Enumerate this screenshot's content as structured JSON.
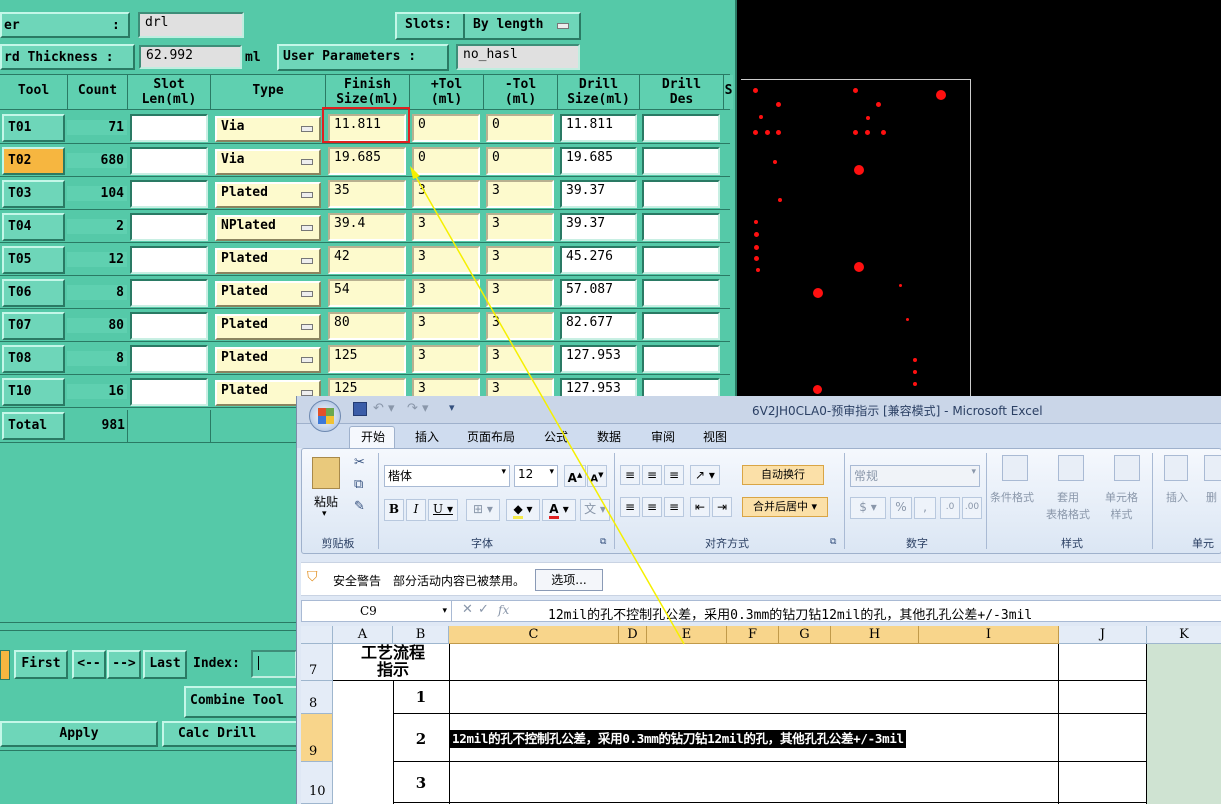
{
  "cam": {
    "header": {
      "layer_label": "er",
      "layer_sep": ":",
      "layer_value": "drl",
      "slots_label": "Slots:",
      "slots_value": "By length",
      "thickness_label": "rd Thickness :",
      "thickness_value": "62.992",
      "thickness_unit": "ml",
      "user_params_label": "User Parameters :",
      "user_params_value": "no_hasl"
    },
    "columns": [
      "Tool",
      "Count",
      "Slot\nLen(ml)",
      "Type",
      "Finish\nSize(ml)",
      "+Tol\n(ml)",
      "-Tol\n(ml)",
      "Drill\nSize(ml)",
      "Drill\nDes",
      "S"
    ],
    "rows": [
      {
        "tool": "T01",
        "count": "71",
        "type": "Via",
        "finish": "11.811",
        "ptol": "0",
        "ntol": "0",
        "drill": "11.811",
        "selected": false
      },
      {
        "tool": "T02",
        "count": "680",
        "type": "Via",
        "finish": "19.685",
        "ptol": "0",
        "ntol": "0",
        "drill": "19.685",
        "selected": true
      },
      {
        "tool": "T03",
        "count": "104",
        "type": "Plated",
        "finish": "35",
        "ptol": "3",
        "ntol": "3",
        "drill": "39.37",
        "selected": false
      },
      {
        "tool": "T04",
        "count": "2",
        "type": "NPlated",
        "finish": "39.4",
        "ptol": "3",
        "ntol": "3",
        "drill": "39.37",
        "selected": false
      },
      {
        "tool": "T05",
        "count": "12",
        "type": "Plated",
        "finish": "42",
        "ptol": "3",
        "ntol": "3",
        "drill": "45.276",
        "selected": false
      },
      {
        "tool": "T06",
        "count": "8",
        "type": "Plated",
        "finish": "54",
        "ptol": "3",
        "ntol": "3",
        "drill": "57.087",
        "selected": false
      },
      {
        "tool": "T07",
        "count": "80",
        "type": "Plated",
        "finish": "80",
        "ptol": "3",
        "ntol": "3",
        "drill": "82.677",
        "selected": false
      },
      {
        "tool": "T08",
        "count": "8",
        "type": "Plated",
        "finish": "125",
        "ptol": "3",
        "ntol": "3",
        "drill": "127.953",
        "selected": false
      },
      {
        "tool": "T10",
        "count": "16",
        "type": "Plated",
        "finish": "125",
        "ptol": "3",
        "ntol": "3",
        "drill": "127.953",
        "selected": false
      }
    ],
    "total_label": "Total",
    "total_value": "981",
    "nav": {
      "first": "First",
      "prev": "<--",
      "next": "-->",
      "last": "Last",
      "index_label": "Index:"
    },
    "combine_tools": "Combine Tool",
    "apply": "Apply",
    "calc_drill": "Calc Drill"
  },
  "excel": {
    "title": "6V2JH0CLA0-预审指示 [兼容模式] - Microsoft Excel",
    "tabs": [
      "开始",
      "插入",
      "页面布局",
      "公式",
      "数据",
      "审阅",
      "视图"
    ],
    "active_tab": "开始",
    "clipboard": {
      "paste": "粘贴",
      "group": "剪贴板"
    },
    "font": {
      "name": "楷体",
      "size": "12",
      "group": "字体"
    },
    "alignment": {
      "wrap": "自动换行",
      "merge": "合并后居中",
      "group": "对齐方式"
    },
    "number": {
      "format": "常规",
      "group": "数字"
    },
    "styles": {
      "cond": "条件格式",
      "table": "套用\n表格格式",
      "cell": "单元格\n样式",
      "group": "样式"
    },
    "cells": {
      "insert": "插入",
      "delete": "删",
      "group": "单元"
    },
    "security": {
      "label": "安全警告",
      "message": "部分活动内容已被禁用。",
      "button": "选项..."
    },
    "formula": {
      "namebox": "C9",
      "fx": "fx",
      "content": "12mil的孔不控制孔公差，采用0.3mm的钻刀钻12mil的孔，其他孔孔公差+/-3mil"
    },
    "col_headers": [
      "A",
      "B",
      "C",
      "D",
      "E",
      "F",
      "G",
      "H",
      "I",
      "J",
      "K"
    ],
    "rows": [
      {
        "num": "7",
        "a": "工艺流程指示",
        "b": "",
        "c": ""
      },
      {
        "num": "8",
        "a": "",
        "b": "1",
        "c": ""
      },
      {
        "num": "9",
        "a": "",
        "b": "2",
        "c": "12mil的孔不控制孔公差，采用0.3mm的钻刀钻12mil的孔，其他孔孔公差+/-3mil"
      },
      {
        "num": "10",
        "a": "",
        "b": "3",
        "c": ""
      }
    ]
  },
  "colors": {
    "cam_bg": "#55c9a8",
    "highlight_box": "#e02020",
    "arrow": "#f5f000",
    "pad": "#ff1010",
    "selected_tool": "#f6b640"
  }
}
